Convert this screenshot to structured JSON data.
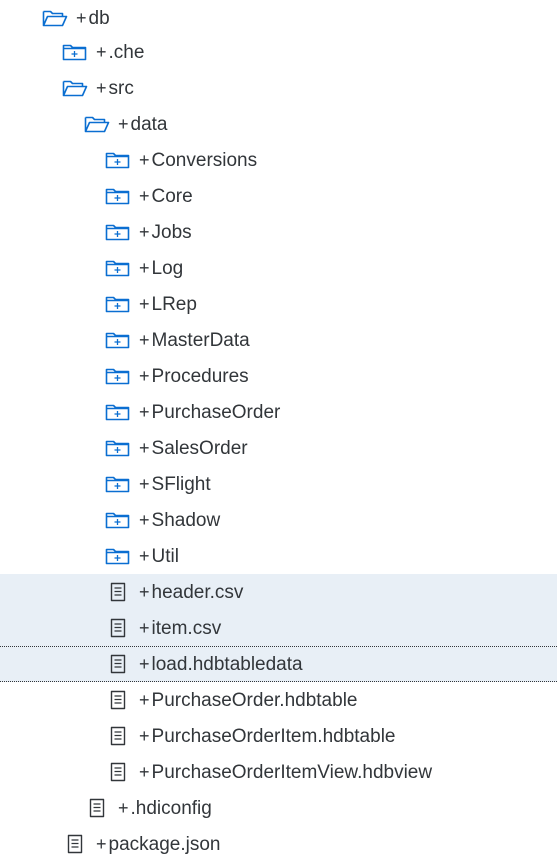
{
  "tree": {
    "items": [
      {
        "label": "db",
        "prefix": "+",
        "icon": "folder-open-icon"
      },
      {
        "label": ".che",
        "prefix": "+",
        "icon": "folder-closed-icon"
      },
      {
        "label": "src",
        "prefix": "+",
        "icon": "folder-open-icon"
      },
      {
        "label": "data",
        "prefix": "+",
        "icon": "folder-open-icon"
      },
      {
        "label": "Conversions",
        "prefix": "+",
        "icon": "folder-closed-icon"
      },
      {
        "label": "Core",
        "prefix": "+",
        "icon": "folder-closed-icon"
      },
      {
        "label": "Jobs",
        "prefix": "+",
        "icon": "folder-closed-icon"
      },
      {
        "label": "Log",
        "prefix": "+",
        "icon": "folder-closed-icon"
      },
      {
        "label": "LRep",
        "prefix": "+",
        "icon": "folder-closed-icon"
      },
      {
        "label": "MasterData",
        "prefix": "+",
        "icon": "folder-closed-icon"
      },
      {
        "label": "Procedures",
        "prefix": "+",
        "icon": "folder-closed-icon"
      },
      {
        "label": "PurchaseOrder",
        "prefix": "+",
        "icon": "folder-closed-icon"
      },
      {
        "label": "SalesOrder",
        "prefix": "+",
        "icon": "folder-closed-icon"
      },
      {
        "label": "SFlight",
        "prefix": "+",
        "icon": "folder-closed-icon"
      },
      {
        "label": "Shadow",
        "prefix": "+",
        "icon": "folder-closed-icon"
      },
      {
        "label": "Util",
        "prefix": "+",
        "icon": "folder-closed-icon"
      },
      {
        "label": "header.csv",
        "prefix": "+",
        "icon": "file-icon"
      },
      {
        "label": "item.csv",
        "prefix": "+",
        "icon": "file-icon"
      },
      {
        "label": "load.hdbtabledata",
        "prefix": "+",
        "icon": "file-icon"
      },
      {
        "label": "PurchaseOrder.hdbtable",
        "prefix": "+",
        "icon": "file-icon"
      },
      {
        "label": "PurchaseOrderItem.hdbtable",
        "prefix": "+",
        "icon": "file-icon"
      },
      {
        "label": "PurchaseOrderItemView.hdbview",
        "prefix": "+",
        "icon": "file-icon"
      },
      {
        "label": ".hdiconfig",
        "prefix": "+",
        "icon": "file-icon"
      },
      {
        "label": "package.json",
        "prefix": "+",
        "icon": "file-icon"
      }
    ]
  },
  "colors": {
    "text": "#32363a",
    "icon": "#0a6ed1",
    "selected_background": "#e8eff6"
  }
}
